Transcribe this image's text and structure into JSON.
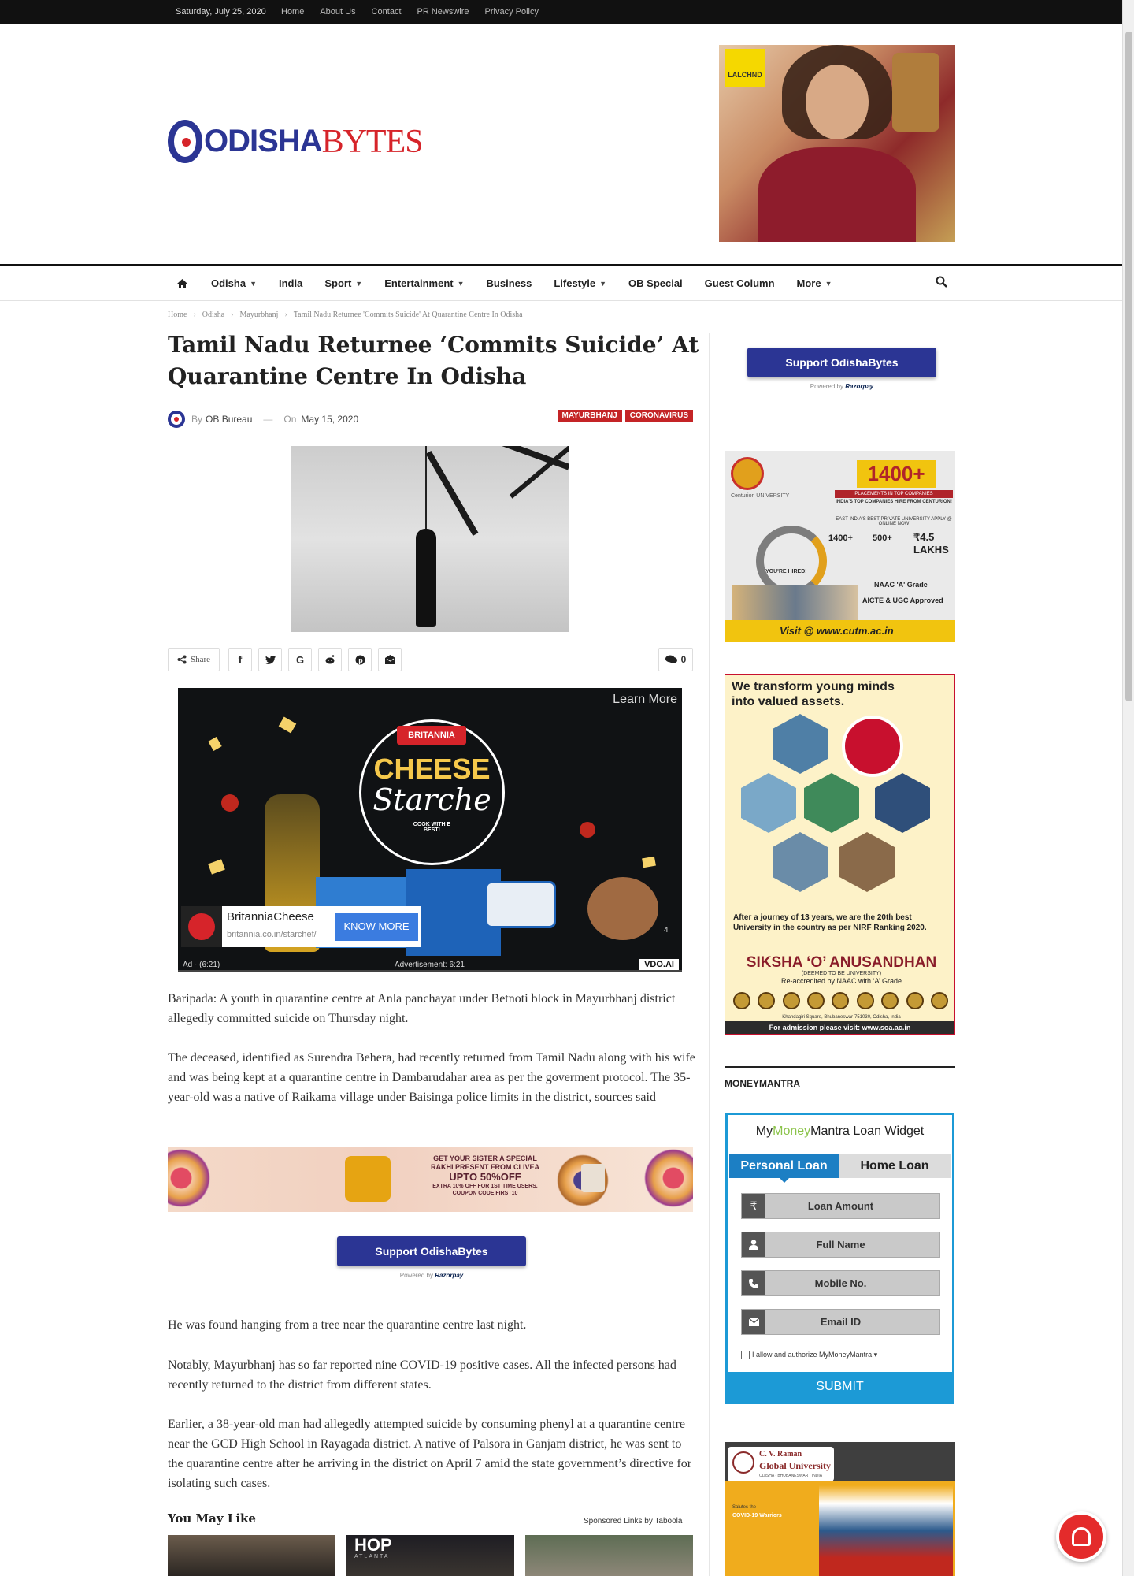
{
  "topbar": {
    "date": "Saturday, July 25, 2020",
    "links": [
      "Home",
      "About Us",
      "Contact",
      "PR Newswire",
      "Privacy Policy"
    ]
  },
  "logo": {
    "part1": "ODISHA",
    "part2": "BYTES"
  },
  "top_ad": {
    "brand": "LALCHND"
  },
  "nav": {
    "items": [
      {
        "label": "Odisha",
        "dropdown": true
      },
      {
        "label": "India",
        "dropdown": false
      },
      {
        "label": "Sport",
        "dropdown": true
      },
      {
        "label": "Entertainment",
        "dropdown": true
      },
      {
        "label": "Business",
        "dropdown": false
      },
      {
        "label": "Lifestyle",
        "dropdown": true
      },
      {
        "label": "OB Special",
        "dropdown": false
      },
      {
        "label": "Guest Column",
        "dropdown": false
      },
      {
        "label": "More",
        "dropdown": true
      }
    ],
    "home_icon": "home-icon",
    "search_icon": "search-icon"
  },
  "breadcrumb": [
    "Home",
    "Odisha",
    "Mayurbhanj",
    "Tamil Nadu Returnee 'Commits Suicide' At Quarantine Centre In Odisha"
  ],
  "article": {
    "title": "Tamil Nadu Returnee ‘Commits Suicide’ At Quarantine Centre In Odisha",
    "by": "By",
    "author": "OB Bureau",
    "on": "On",
    "date": "May 15, 2020",
    "tags": [
      "MAYURBHANJ",
      "CORONAVIRUS"
    ],
    "share_label": "Share",
    "comment_count": "0",
    "paragraphs": [
      "Baripada: A youth in quarantine centre at Anla panchayat under Betnoti block in Mayurbhanj district allegedly committed suicide on Thursday night.",
      "The deceased, identified as Surendra Behera, had recently returned from Tamil Nadu along with his wife and was being kept at a quarantine centre in Dambarudahar area as per the goverment protocol. The 35-year-old was a native of Raikama village under Baisinga police limits in the district, sources said",
      "He was found hanging from a tree near the quarantine centre last night.",
      "Notably, Mayurbhanj has so far reported nine COVID-19 positive cases. All the infected persons had recently returned to the district from different states.",
      "Earlier, a 38-year-old man had allegedly attempted suicide by consuming phenyl at a quarantine centre near the GCD High School in Rayagada district. A native of Palsora in Ganjam district, he was sent to the quarantine centre after he arriving in the district on April 7 amid the state government’s directive for isolating such cases."
    ]
  },
  "video_ad": {
    "learn_more": "Learn More",
    "brand_tag": "BRITANNIA",
    "title1": "CHEESE",
    "title2": "Starche",
    "tagline": "COOK WITH E BEST!",
    "advertiser": "BritanniaCheese",
    "url": "britannia.co.in/starchef/",
    "cta": "KNOW MORE",
    "ad_label": "Ad · (6:21)",
    "ad_time": "Advertisement: 6:21",
    "counter": "4",
    "vdo": "VDO.AI"
  },
  "banner_ad": {
    "line1": "GET YOUR SISTER A SPECIAL",
    "line2": "RAKHI PRESENT FROM CLIVEA",
    "line3": "UPTO 50%OFF",
    "line4": "EXTRA 10% OFF FOR 1ST TIME USERS.",
    "line5": "COUPON CODE FIRST10"
  },
  "support": {
    "label": "Support OdishaBytes",
    "powered": "Powered by",
    "razorpay": "Razorpay"
  },
  "related": {
    "heading": "You May Like",
    "sponsor": "Sponsored Links by Taboola",
    "thumb2_text": "HOP",
    "thumb2_sub": "ATLANTA"
  },
  "cu_ad": {
    "name": "Centurion UNIVERSITY",
    "big": "1400+",
    "placements": "PLACEMENTS IN TOP COMPANIES",
    "l1": "INDIA'S TOP COMPANIES HIRE FROM CENTURION!",
    "l2": "EAST INDIA'S BEST PRIVATE UNIVERSITY APPLY @ ONLINE NOW",
    "n1": "1400+",
    "n2": "500+",
    "n3": "₹4.5 LAKHS",
    "hired": "YOU'RE HIRED!",
    "naac": "NAAC 'A' Grade",
    "aicte": "AICTE & UGC Approved",
    "visit": "Visit @ www.cutm.ac.in"
  },
  "soa_ad": {
    "headline": "We transform young minds into valued assets.",
    "journey": "After a journey of 13 years, we are the 20th best University in the country as per NIRF Ranking 2020.",
    "name": "SIKSHA ‘O’ ANUSANDHAN",
    "deemed": "(DEEMED TO BE UNIVERSITY)",
    "naac": "Re-accredited by NAAC with ‘A’ Grade",
    "address": "Khandagiri Square, Bhubaneswar-751030, Odisha, India",
    "admission": "For admission please visit: www.soa.ac.in"
  },
  "moneymantra": {
    "heading": "MONEYMANTRA",
    "widget_title_a": "My",
    "widget_title_b": "Money",
    "widget_title_c": "Mantra Loan Widget",
    "tab_active": "Personal Loan",
    "tab_other": "Home Loan",
    "fields": [
      {
        "icon": "₹",
        "label": "Loan Amount"
      },
      {
        "icon": "person",
        "label": "Full Name"
      },
      {
        "icon": "phone",
        "label": "Mobile No."
      },
      {
        "icon": "envelope",
        "label": "Email ID"
      }
    ],
    "consent": "I allow and authorize MyMoneyMantra ▾",
    "submit": "SUBMIT"
  },
  "cv_ad": {
    "t1": "C. V. Raman",
    "t2": "Global University",
    "t3": "ODISHA · BHUBANESWAR · INDIA",
    "salutes": "Salutes the",
    "warriors": "COVID-19 Warriors"
  }
}
